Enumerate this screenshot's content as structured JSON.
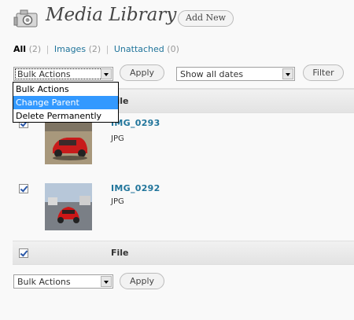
{
  "header": {
    "title": "Media Library",
    "add_new_label": "Add New",
    "icon": "media-camera-icon"
  },
  "filters": {
    "all_label": "All",
    "all_count": "(2)",
    "images_label": "Images",
    "images_count": "(2)",
    "unattached_label": "Unattached",
    "unattached_count": "(0)",
    "separator": "|"
  },
  "toolbar_top": {
    "bulk_selected": "Bulk Actions",
    "apply_label": "Apply",
    "dates_selected": "Show all dates",
    "filter_label": "Filter"
  },
  "bulk_menu": {
    "options": [
      "Bulk Actions",
      "Change Parent",
      "Delete Permanently"
    ],
    "highlighted": "Change Parent"
  },
  "table": {
    "header_file": "File",
    "footer_file": "File",
    "rows": [
      {
        "title": "IMG_0293",
        "type": "JPG",
        "checked": true
      },
      {
        "title": "IMG_0292",
        "type": "JPG",
        "checked": true
      }
    ]
  },
  "toolbar_bottom": {
    "bulk_selected": "Bulk Actions",
    "apply_label": "Apply"
  },
  "colors": {
    "link": "#21759b",
    "highlight": "#3399ff"
  }
}
